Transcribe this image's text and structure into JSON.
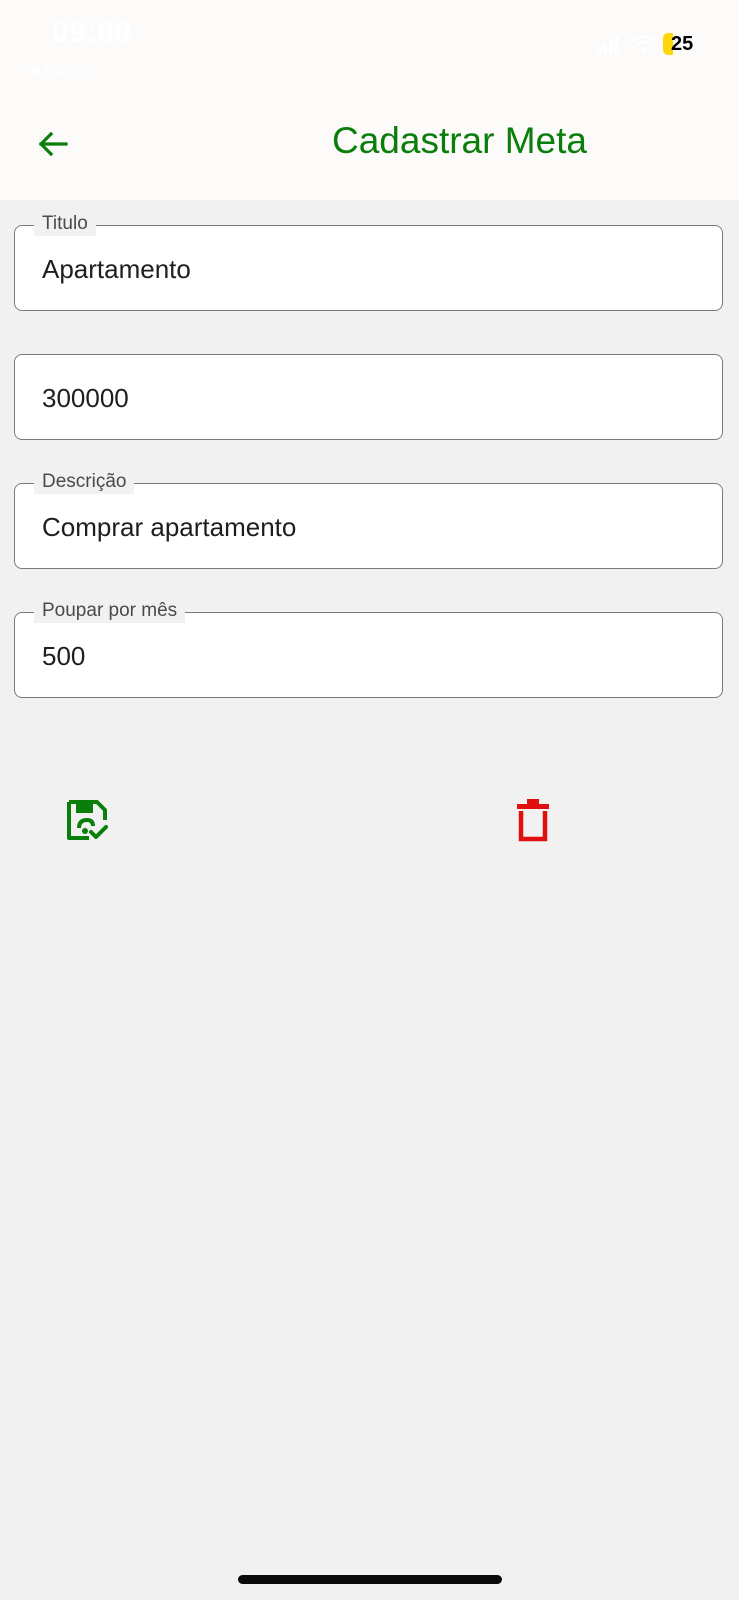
{
  "status_bar": {
    "time": "09:00",
    "back_label": "◀ Busca",
    "battery": "25",
    "battery_color": "#ffd60a"
  },
  "app_bar": {
    "title": "Cadastrar Meta",
    "back_icon": "arrow-left-icon",
    "accent_color": "#0a7e0a"
  },
  "form": {
    "titulo": {
      "label": "Titulo",
      "value": "Apartamento"
    },
    "valor": {
      "label": "",
      "value": "300000"
    },
    "descricao": {
      "label": "Descrição",
      "value": "Comprar apartamento"
    },
    "poupar": {
      "label": "Poupar por mês",
      "value": "500"
    }
  },
  "actions": {
    "save_icon": "save-check-icon",
    "save_color": "#0a7e0a",
    "delete_icon": "trash-icon",
    "delete_color": "#e01010"
  }
}
